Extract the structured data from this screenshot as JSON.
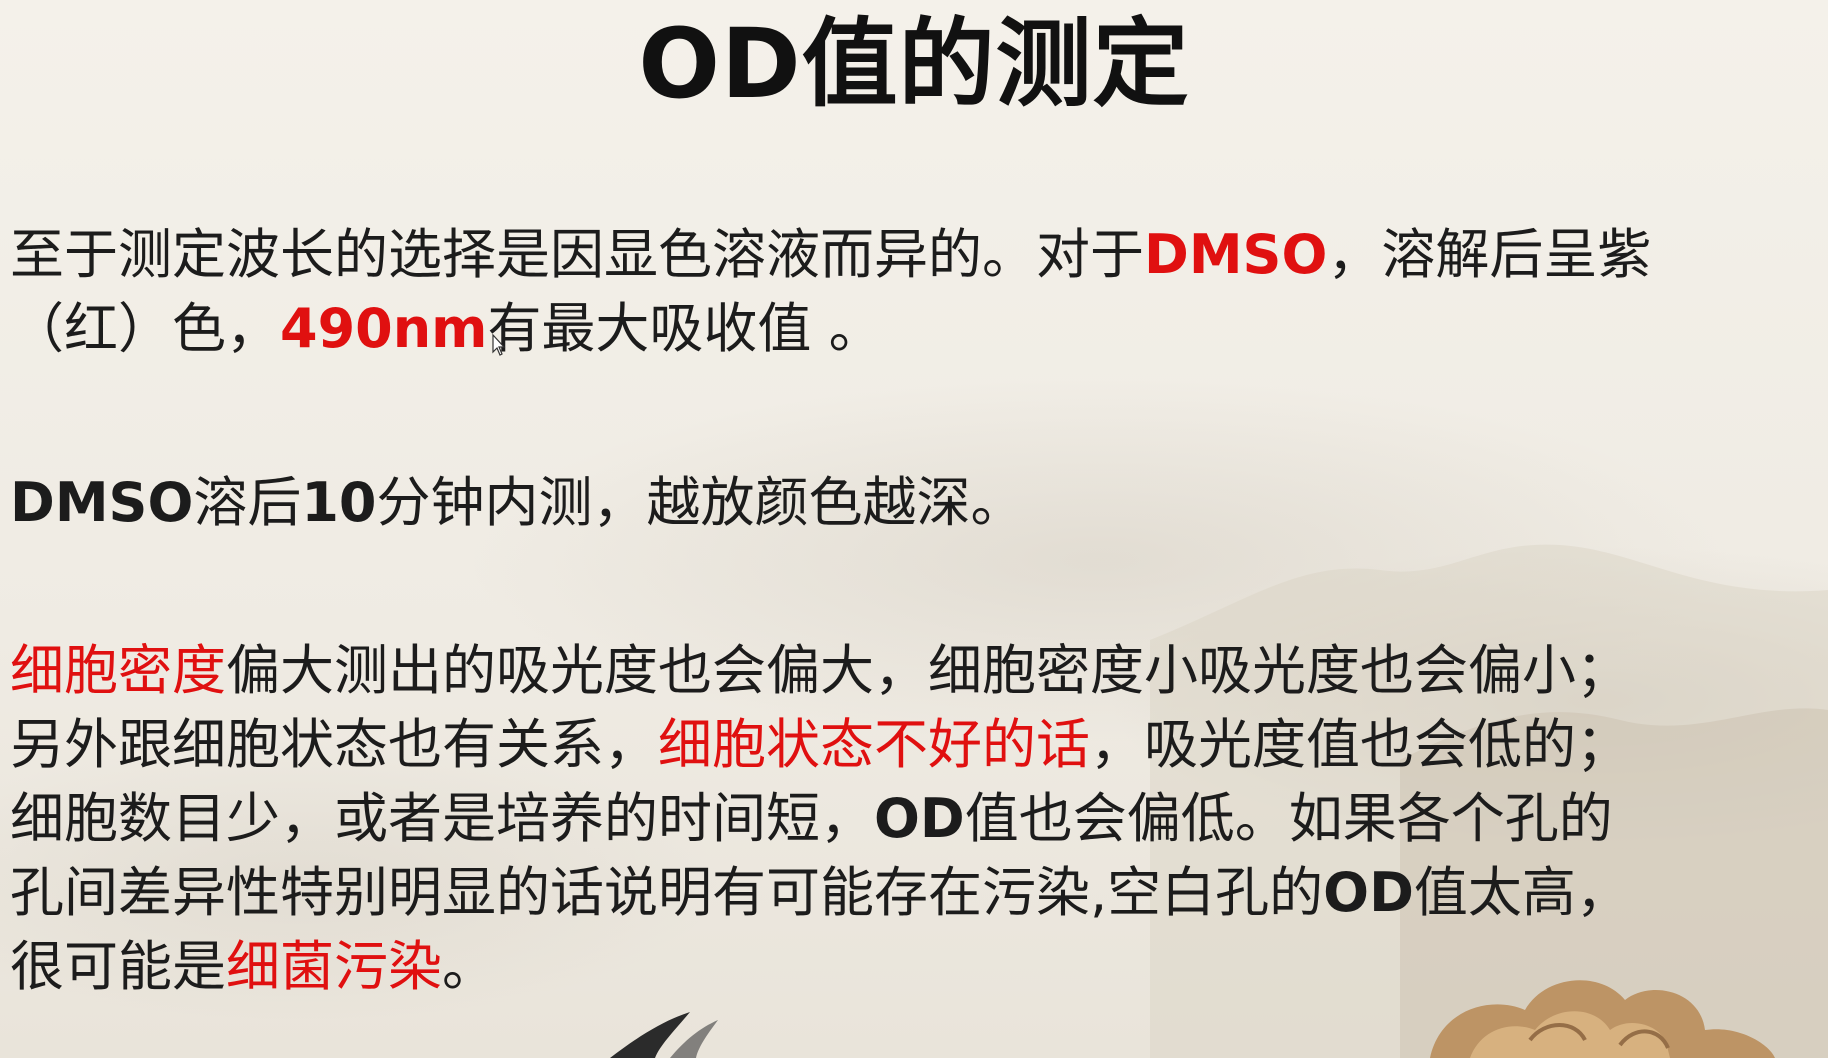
{
  "slide": {
    "title": "OD值的测定",
    "paragraph1": {
      "line1": [
        {
          "text": "至于测定波长的选择是因显色溶液而异的。对于",
          "style": "normal"
        },
        {
          "text": "DMSO",
          "style": "red-bold"
        },
        {
          "text": "，溶解后呈紫",
          "style": "normal"
        }
      ],
      "line2": [
        {
          "text": "（红）色，",
          "style": "normal"
        },
        {
          "text": "490nm",
          "style": "red-bold"
        },
        {
          "text": "有最大吸收值 。",
          "style": "normal"
        }
      ]
    },
    "paragraph2": {
      "line1": [
        {
          "text": "DMSO",
          "style": "bold"
        },
        {
          "text": "溶后",
          "style": "normal"
        },
        {
          "text": "10",
          "style": "bold"
        },
        {
          "text": "分钟内测，越放颜色越深。",
          "style": "normal"
        }
      ]
    },
    "paragraph3": {
      "line1": [
        {
          "text": "细胞密度",
          "style": "red"
        },
        {
          "text": "偏大测出的吸光度也会偏大，细胞密度小吸光度也会偏小；",
          "style": "normal"
        }
      ],
      "line2": [
        {
          "text": "另外跟细胞状态也有关系，",
          "style": "normal"
        },
        {
          "text": "细胞状态不好的话",
          "style": "red"
        },
        {
          "text": "，吸光度值也会低的；",
          "style": "normal"
        }
      ],
      "line3": [
        {
          "text": "细胞数目少，或者是培养的时间短，",
          "style": "normal"
        },
        {
          "text": "OD",
          "style": "bold"
        },
        {
          "text": "值也会偏低。如果各个孔的",
          "style": "normal"
        }
      ],
      "line4": [
        {
          "text": "孔间差异性特别明显的话说明有可能存在污染,空白孔的",
          "style": "normal"
        },
        {
          "text": "OD",
          "style": "bold"
        },
        {
          "text": "值太高，",
          "style": "normal"
        }
      ],
      "line5": [
        {
          "text": "很可能是",
          "style": "normal"
        },
        {
          "text": "细菌污染",
          "style": "red"
        },
        {
          "text": "。",
          "style": "normal"
        }
      ]
    }
  },
  "colors": {
    "highlight_red": "#e01010",
    "text": "#1c1c1c",
    "background": "#f2efe8"
  }
}
